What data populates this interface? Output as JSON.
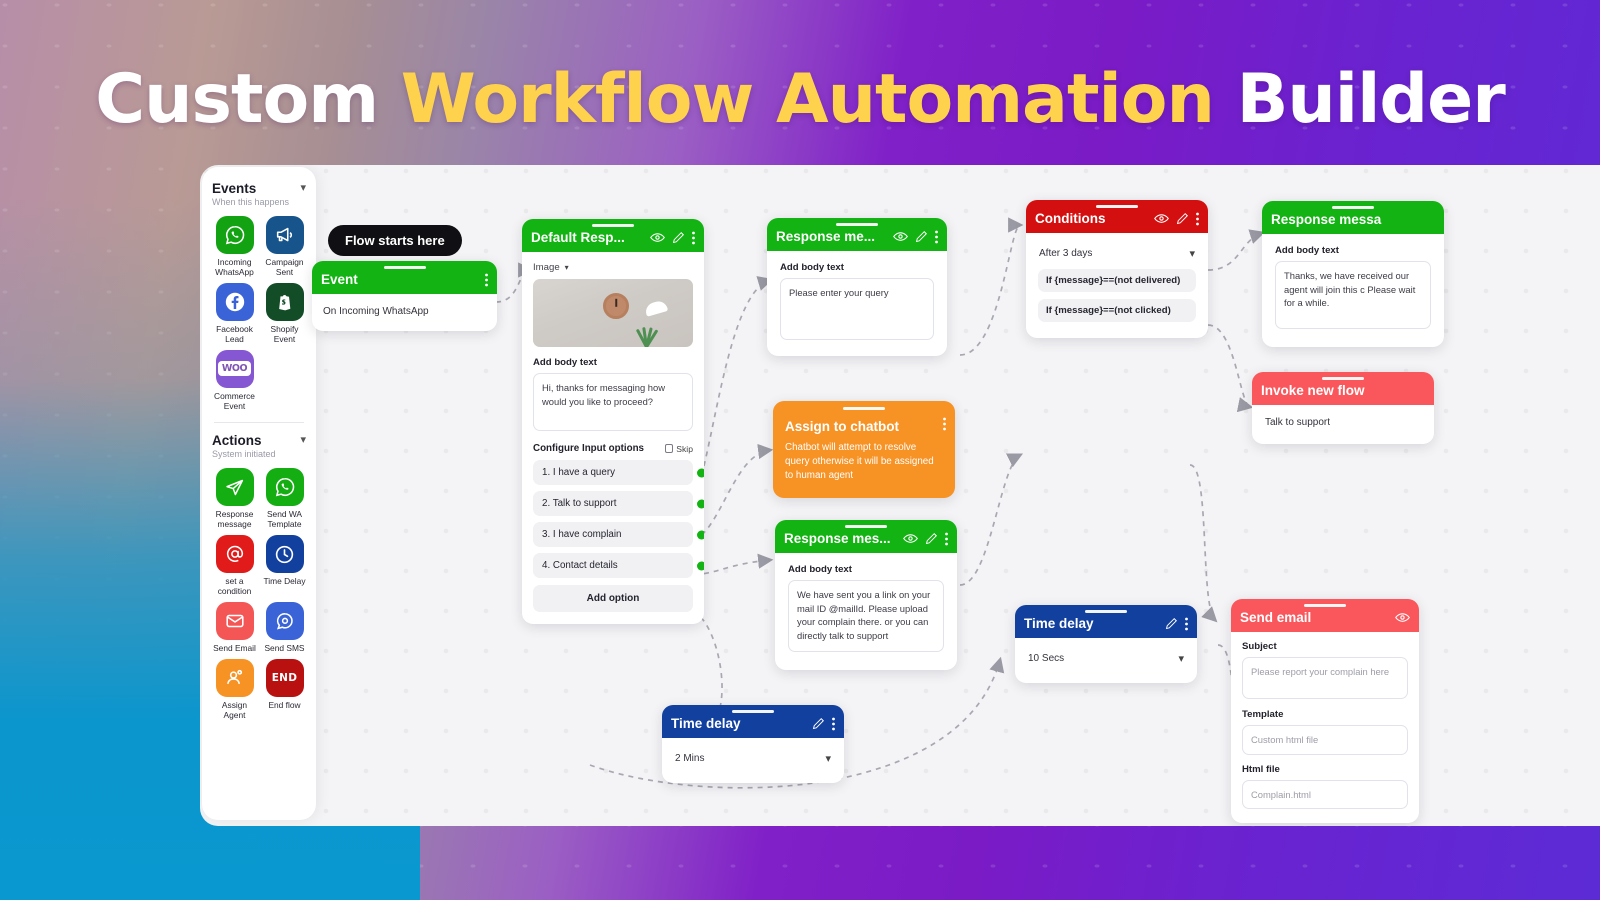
{
  "title": {
    "part1": "Custom ",
    "accent": "Workflow Automation",
    "part2": " Builder"
  },
  "sidebar": {
    "events": {
      "heading": "Events",
      "subheading": "When this happens",
      "chevron": "chevron-down",
      "items": [
        {
          "label": "Incoming WhatsApp",
          "icon": "whatsapp-icon",
          "color": "#13a312"
        },
        {
          "label": "Campaign Sent",
          "icon": "megaphone-icon",
          "color": "#17548c"
        },
        {
          "label": "Facebook Lead",
          "icon": "facebook-icon",
          "color": "#3b63d8"
        },
        {
          "label": "Shopify Event",
          "icon": "shopify-icon",
          "color": "#124d28"
        },
        {
          "label": "Commerce Event",
          "icon": "woocommerce-icon",
          "color": "#8657d3"
        }
      ]
    },
    "actions": {
      "heading": "Actions",
      "subheading": "System initiated",
      "chevron": "chevron-down",
      "items": [
        {
          "label": "Response message",
          "icon": "send-plane-icon",
          "color": "#14ad12"
        },
        {
          "label": "Send WA Template",
          "icon": "whatsapp-icon",
          "color": "#14ad12"
        },
        {
          "label": "set a condition",
          "icon": "at-sign-icon",
          "color": "#e11a1a"
        },
        {
          "label": "Time Delay",
          "icon": "clock-icon",
          "color": "#12409e"
        },
        {
          "label": "Send Email",
          "icon": "envelope-icon",
          "color": "#f45656"
        },
        {
          "label": "Send SMS",
          "icon": "chat-bubble-icon",
          "color": "#3b63d8"
        },
        {
          "label": "Assign Agent",
          "icon": "agent-icon",
          "color": "#f79224"
        },
        {
          "label": "End flow",
          "icon": "end-label",
          "color": "#b91010",
          "text": "END"
        }
      ]
    }
  },
  "canvas": {
    "flow_start_badge": "Flow starts here",
    "nodes": {
      "event": {
        "title": "Event",
        "header_color": "#12b312",
        "value": "On Incoming WhatsApp",
        "kebab": "kebab-menu-icon"
      },
      "default_response": {
        "title": "Default Resp...",
        "header_color": "#12b312",
        "media_type": "Image",
        "body_label": "Add body text",
        "body_text": "Hi, thanks for messaging how would you like to proceed?",
        "configure_label": "Configure Input options",
        "skip_label": "Skip",
        "options": [
          "1. I have a query",
          "2. Talk to support",
          "3. I have complain",
          "4. Contact details"
        ],
        "add_option": "Add option"
      },
      "response_query": {
        "title": "Response me...",
        "header_color": "#12b312",
        "body_label": "Add body text",
        "body_text": "Please enter your query"
      },
      "assign_chatbot": {
        "title": "Assign to chatbot",
        "header_color": "#f79224",
        "body_text": "Chatbot will attempt to resolve query otherwise it will be assigned to human agent"
      },
      "response_complain": {
        "title": "Response mes...",
        "header_color": "#12b312",
        "body_label": "Add body text",
        "body_text": "We have sent you a link on your mail ID @mailId. Please upload your complain there. or you can directly talk to support"
      },
      "conditions": {
        "title": "Conditions",
        "header_color": "#d40f0f",
        "delay_value": "After 3 days",
        "rules": [
          "If {message}==(not delivered)",
          "If {message}==(not clicked)"
        ]
      },
      "response_agent": {
        "title": "Response messa",
        "header_color": "#12b312",
        "body_label": "Add body text",
        "body_text": "Thanks, we have received our agent will join this c Please wait for a while."
      },
      "invoke_flow": {
        "title": "Invoke new flow",
        "header_color": "#f9575b",
        "value": "Talk to support"
      },
      "time_delay_10s": {
        "title": "Time delay",
        "header_color": "#12409e",
        "value": "10 Secs"
      },
      "time_delay_2m": {
        "title": "Time delay",
        "header_color": "#12409e",
        "value": "2 Mins"
      },
      "send_email": {
        "title": "Send email",
        "header_color": "#f9575b",
        "subject_label": "Subject",
        "subject_placeholder": "Please report your complain here",
        "template_label": "Template",
        "template_value": "Custom html file",
        "htmlfile_label": "Html file",
        "htmlfile_value": "Complain.html"
      }
    }
  },
  "colors": {
    "green": "#12b312",
    "red": "#d40f0f",
    "coral": "#f9575b",
    "blue": "#12409e",
    "orange": "#f79224",
    "accent_yellow": "#ffd24d",
    "canvas_bg": "#f4f4f6"
  }
}
